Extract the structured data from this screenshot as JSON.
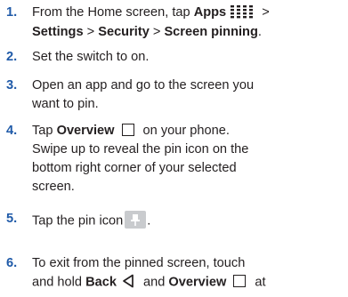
{
  "steps": [
    {
      "number": "1.",
      "lines": [
        {
          "parts": [
            "From the Home screen, tap ",
            "Apps",
            " >"
          ],
          "icon": "apps-grid-icon"
        },
        {
          "parts": [
            "Settings",
            " > ",
            "Security",
            " > ",
            "Screen pinning",
            "."
          ]
        }
      ]
    },
    {
      "number": "2.",
      "lines": [
        {
          "text": "Set the switch to on."
        }
      ]
    },
    {
      "number": "3.",
      "lines": [
        {
          "text": "Open an app and go to the screen you"
        },
        {
          "text": "want to pin."
        }
      ]
    },
    {
      "number": "4.",
      "lines": [
        {
          "parts": [
            "Tap ",
            "Overview",
            " on your phone."
          ],
          "icon": "overview-square-icon"
        },
        {
          "text": "Swipe up to reveal the pin icon on the"
        },
        {
          "text": "bottom right corner of your selected"
        },
        {
          "text": "screen."
        }
      ]
    },
    {
      "number": "5.",
      "lines": [
        {
          "parts": [
            "Tap the pin icon",
            "."
          ],
          "icon": "pin-icon"
        }
      ]
    },
    {
      "number": "6.",
      "lines": [
        {
          "text": "To exit from the pinned screen, touch"
        },
        {
          "parts": [
            "and hold ",
            "Back",
            " and ",
            "Overview",
            " at"
          ],
          "icons": [
            "back-triangle-icon",
            "overview-square-icon"
          ]
        }
      ]
    }
  ]
}
